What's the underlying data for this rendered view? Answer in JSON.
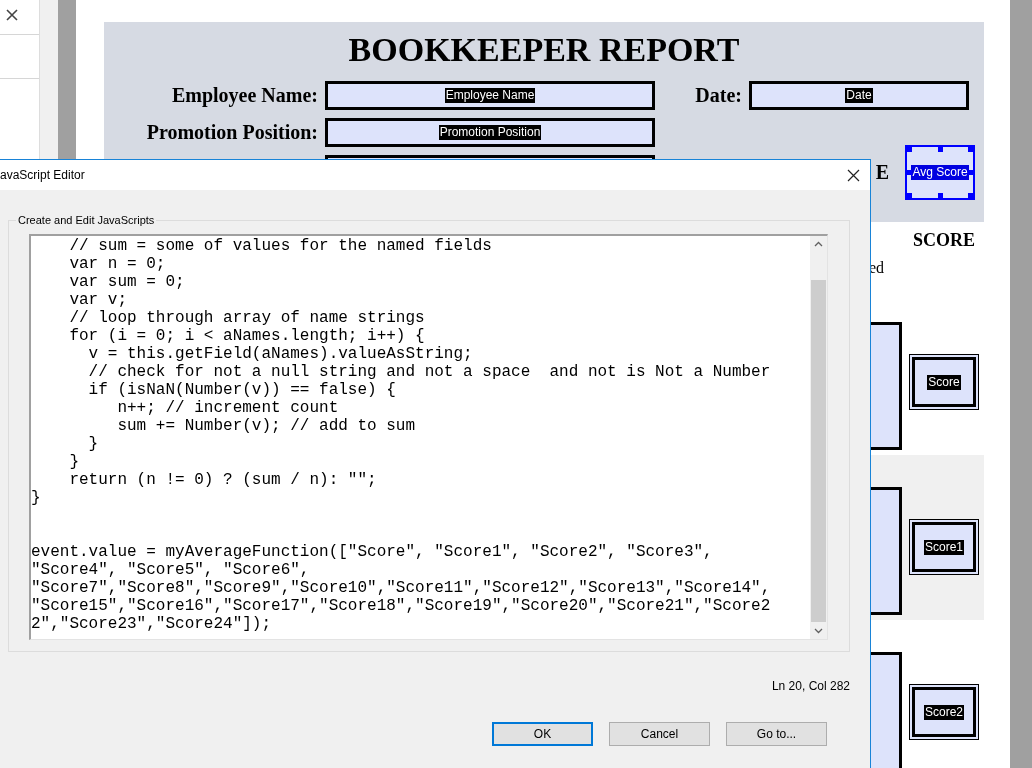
{
  "form": {
    "title": "BOOKKEEPER REPORT",
    "header_fields": [
      {
        "label": "Employee Name:",
        "field_name": "Employee Name"
      },
      {
        "label": "Date:",
        "field_name": "Date"
      },
      {
        "label": "Promotion Position:",
        "field_name": "Promotion Position"
      }
    ],
    "heading_fragment": "E",
    "avg_field": {
      "field_name": "Avg Score",
      "selected": true
    },
    "score_heading": "SCORE",
    "note_fragment": "ed",
    "score_fields": [
      {
        "field_name": "Score"
      },
      {
        "field_name": "Score1"
      },
      {
        "field_name": "Score2"
      }
    ]
  },
  "dialog": {
    "title": "avaScript Editor",
    "group_label": "Create and Edit JavaScripts",
    "code": "    // sum = some of values for the named fields\n    var n = 0;\n    var sum = 0;\n    var v;\n    // loop through array of name strings\n    for (i = 0; i < aNames.length; i++) {\n      v = this.getField(aNames).valueAsString;\n      // check for not a null string and not a space  and not is Not a Number\n      if (isNaN(Number(v)) == false) {\n         n++; // increment count\n         sum += Number(v); // add to sum\n      }\n    }\n    return (n != 0) ? (sum / n): \"\";\n}\n\n\nevent.value = myAverageFunction([\"Score\", \"Score1\", \"Score2\", \"Score3\",\n\"Score4\", \"Score5\", \"Score6\",\n\"Score7\",\"Score8\",\"Score9\",\"Score10\",\"Score11\",\"Score12\",\"Score13\",\"Score14\",\n\"Score15\",\"Score16\",\"Score17\",\"Score18\",\"Score19\",\"Score20\",\"Score21\",\"Score2\n2\",\"Score23\",\"Score24\"]);",
    "cursor_position": "Ln 20, Col 282",
    "buttons": [
      {
        "label": "OK",
        "default": true
      },
      {
        "label": "Cancel",
        "default": false
      },
      {
        "label": "Go to...",
        "default": false
      }
    ]
  }
}
